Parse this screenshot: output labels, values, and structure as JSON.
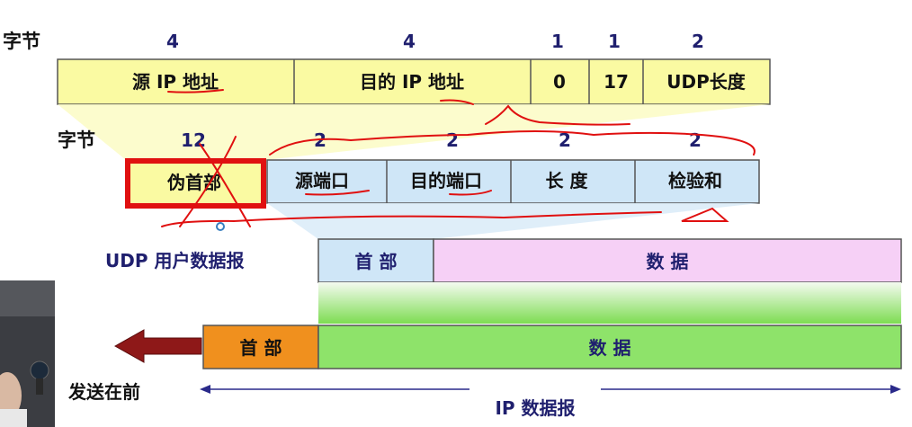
{
  "pseudo_header": {
    "bytes_label": "字节",
    "byte_counts": [
      "4",
      "4",
      "1",
      "1",
      "2"
    ],
    "fields": [
      "源 IP 地址",
      "目的 IP 地址",
      "0",
      "17",
      "UDP长度"
    ]
  },
  "udp_header": {
    "bytes_label": "字节",
    "byte_counts": [
      "12",
      "2",
      "2",
      "2",
      "2"
    ],
    "pseudo_label": "伪首部",
    "fields": [
      "源端口",
      "目的端口",
      "长 度",
      "检验和"
    ]
  },
  "udp_datagram": {
    "label": "UDP 用户数据报",
    "header": "首 部",
    "data": "数 据"
  },
  "ip_datagram": {
    "header": "首 部",
    "data": "数 据",
    "send_first": "发送在前",
    "label": "IP 数据报"
  },
  "colors": {
    "pseudo_fill": "#fafaa2",
    "udp_fill": "#cfe6f7",
    "data_fill": "#f6d0f6",
    "green": "#8ee36a",
    "orange": "#f0901e",
    "arrow_red": "#8e1818",
    "annotation_red": "#e01010",
    "text": "#1f1f6e"
  }
}
